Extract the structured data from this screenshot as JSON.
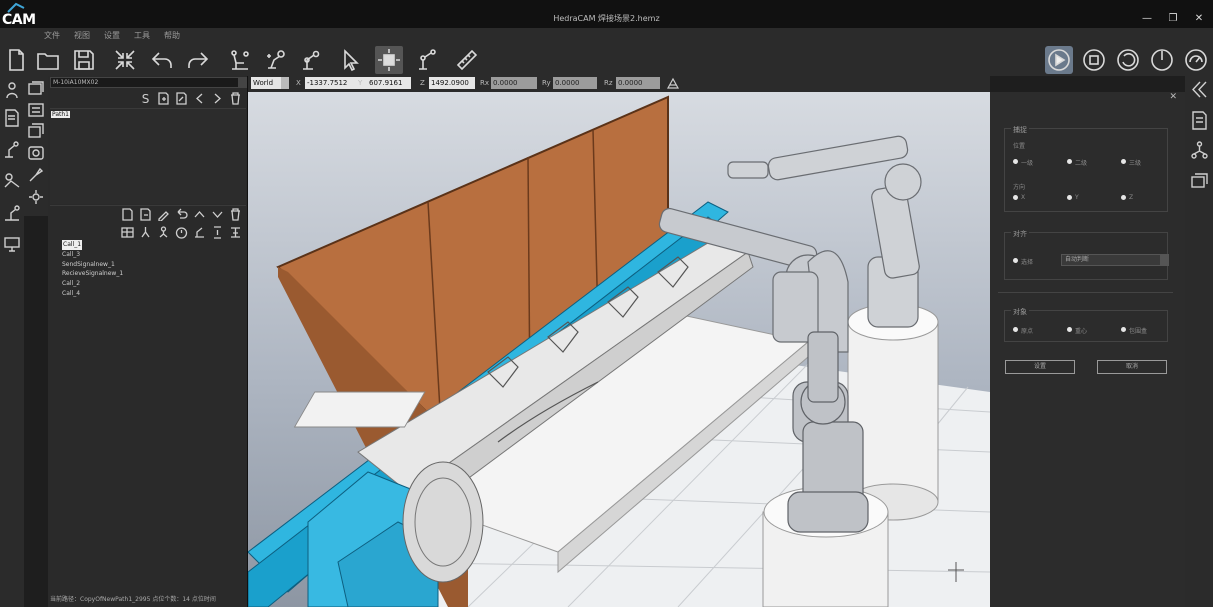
{
  "app": {
    "logo": "CAM",
    "title": "HedraCAM  焊接场景2.hemz",
    "window_buttons": [
      "—",
      "❐",
      "✕"
    ]
  },
  "menu": [
    "文件",
    "视图",
    "设置",
    "工具",
    "帮助"
  ],
  "toolbar": {
    "left_icons": [
      "new-file-icon",
      "open-folder-icon",
      "save-icon",
      "collapse-arrows-icon",
      "undo-icon",
      "redo-icon",
      "robot-path-icon",
      "robot-add-icon",
      "robot-config-icon",
      "select-cursor-icon",
      "move-object-icon",
      "robot-teach-icon",
      "ruler-icon"
    ],
    "right_icons": [
      "play-icon",
      "stop-icon",
      "rotate-ccw-icon",
      "rotate-cw-icon",
      "gauge-icon"
    ]
  },
  "left_panel": {
    "robot_selector": "M-10iA10MX02",
    "path_tools": [
      "S",
      "path-add-icon",
      "path-edit-icon",
      "prev-icon",
      "next-icon",
      "delete-icon"
    ],
    "paths": [
      "Path1"
    ],
    "call_tools_row1": [
      "insert-icon",
      "insert-after-icon",
      "edit-icon",
      "undo-small-icon",
      "move-up-icon",
      "move-down-icon",
      "delete-icon"
    ],
    "call_tools_row2": [
      "table-icon",
      "branch-icon",
      "tree-icon",
      "timer-icon",
      "signal-icon",
      "wait-icon",
      "output-icon"
    ],
    "calls": [
      "Call_1",
      "Call_3",
      "SendSignalnew_1",
      "RecieveSignalnew_1",
      "Call_2",
      "Call_4"
    ],
    "status": "当前路径：CopyOfNewPath1_2995  点位个数：14  点位时间"
  },
  "coords": {
    "frame": "World",
    "fields": [
      {
        "label": "X",
        "value": "-1337.7512"
      },
      {
        "label": "Y",
        "value": "607.9161"
      },
      {
        "label": "Z",
        "value": "1492.0900"
      },
      {
        "label": "Rx",
        "value": "0.0000"
      },
      {
        "label": "Ry",
        "value": "0.0000"
      },
      {
        "label": "Rz",
        "value": "0.0000"
      }
    ]
  },
  "right_panel": {
    "close": "✕",
    "capture": {
      "title": "捕捉",
      "position_label": "位置",
      "position_options": [
        "一级",
        "二级",
        "三级"
      ],
      "direction_label": "方向",
      "direction_options": [
        "X",
        "Y",
        "Z"
      ]
    },
    "align": {
      "title": "对齐",
      "option": "选择",
      "dropdown": "自动判断"
    },
    "object": {
      "title": "对象",
      "options": [
        "原点",
        "重心",
        "包围盒"
      ]
    },
    "buttons": {
      "apply": "设置",
      "cancel": "取消"
    }
  }
}
